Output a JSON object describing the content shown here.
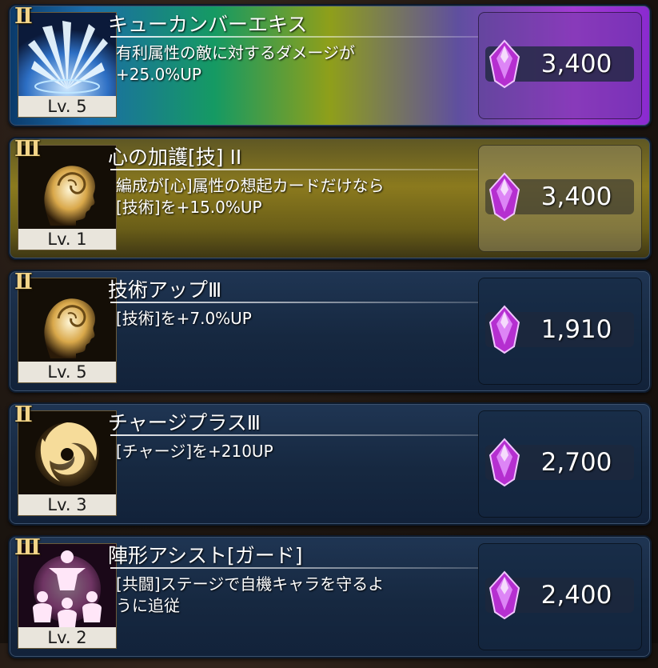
{
  "skills": [
    {
      "rank": "Ⅱ",
      "level": "Lv. 5",
      "name": "キューカンバーエキス",
      "desc_line1": "有利属性の敵に対するダメージが",
      "desc_line2": "+25.0%UP",
      "price": "3,400",
      "icon": "ice-burst-icon",
      "theme": "rainbow"
    },
    {
      "rank": "Ⅲ",
      "level": "Lv. 1",
      "name": "心の加護[技] II",
      "desc_line1": "編成が[心]属性の想起カードだけなら",
      "desc_line2": "[技術]を+15.0%UP",
      "price": "3,400",
      "icon": "head-mind-icon",
      "theme": "gold"
    },
    {
      "rank": "Ⅱ",
      "level": "Lv. 5",
      "name": "技術アップⅢ",
      "desc_line1": "[技術]を+7.0%UP",
      "desc_line2": "",
      "price": "1,910",
      "icon": "head-mind-icon",
      "theme": "blue"
    },
    {
      "rank": "Ⅱ",
      "level": "Lv. 3",
      "name": "チャージプラスⅢ",
      "desc_line1": "[チャージ]を+210UP",
      "desc_line2": "",
      "price": "2,700",
      "icon": "swirl-charge-icon",
      "theme": "blue"
    },
    {
      "rank": "Ⅲ",
      "level": "Lv. 2",
      "name": "陣形アシスト[ガード]",
      "desc_line1": "[共闘]ステージで自機キャラを守るよ",
      "desc_line2": "うに追従",
      "price": "2,400",
      "icon": "formation-guard-icon",
      "theme": "blue"
    }
  ],
  "colors": {
    "gem": "#c23fd6",
    "rank": "#f2d488",
    "card_blue": "#1c3150"
  }
}
